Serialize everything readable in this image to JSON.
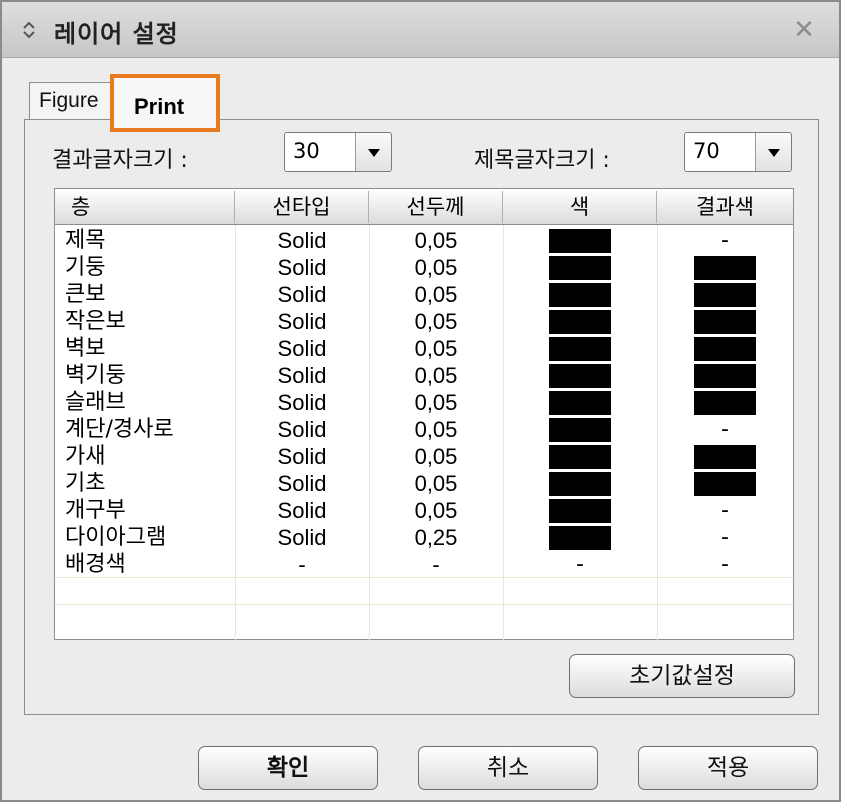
{
  "window": {
    "title": "레이어 설정",
    "close_glyph": "✕"
  },
  "tabs": [
    {
      "label": "Figure"
    },
    {
      "label": "Print"
    }
  ],
  "settings": {
    "result_font_label": "결과글자크기 :",
    "result_font_value": "30",
    "title_font_label": "제목글자크기 :",
    "title_font_value": "70"
  },
  "table": {
    "headers": [
      "층",
      "선타입",
      "선두께",
      "색",
      "결과색"
    ],
    "rows": [
      {
        "name": "제목",
        "line": "Solid",
        "thick": "0,05",
        "color": "#000000",
        "result": "-"
      },
      {
        "name": "기둥",
        "line": "Solid",
        "thick": "0,05",
        "color": "#000000",
        "result": "#000000"
      },
      {
        "name": "큰보",
        "line": "Solid",
        "thick": "0,05",
        "color": "#000000",
        "result": "#000000"
      },
      {
        "name": "작은보",
        "line": "Solid",
        "thick": "0,05",
        "color": "#000000",
        "result": "#000000"
      },
      {
        "name": "벽보",
        "line": "Solid",
        "thick": "0,05",
        "color": "#000000",
        "result": "#000000"
      },
      {
        "name": "벽기둥",
        "line": "Solid",
        "thick": "0,05",
        "color": "#000000",
        "result": "#000000"
      },
      {
        "name": "슬래브",
        "line": "Solid",
        "thick": "0,05",
        "color": "#000000",
        "result": "#000000"
      },
      {
        "name": "계단/경사로",
        "line": "Solid",
        "thick": "0,05",
        "color": "#000000",
        "result": "-"
      },
      {
        "name": "가새",
        "line": "Solid",
        "thick": "0,05",
        "color": "#000000",
        "result": "#000000"
      },
      {
        "name": "기초",
        "line": "Solid",
        "thick": "0,05",
        "color": "#000000",
        "result": "#000000"
      },
      {
        "name": "개구부",
        "line": "Solid",
        "thick": "0,05",
        "color": "#000000",
        "result": "-"
      },
      {
        "name": "다이아그램",
        "line": "Solid",
        "thick": "0,25",
        "color": "#000000",
        "result": "-"
      },
      {
        "name": "배경색",
        "line": "-",
        "thick": "-",
        "color": "-",
        "result": "-"
      }
    ]
  },
  "buttons": {
    "reset": "초기값설정",
    "ok": "확인",
    "cancel": "취소",
    "apply": "적용"
  },
  "colors": {
    "highlight_tab_border": "#e87b1e",
    "swatch": "#000000"
  }
}
